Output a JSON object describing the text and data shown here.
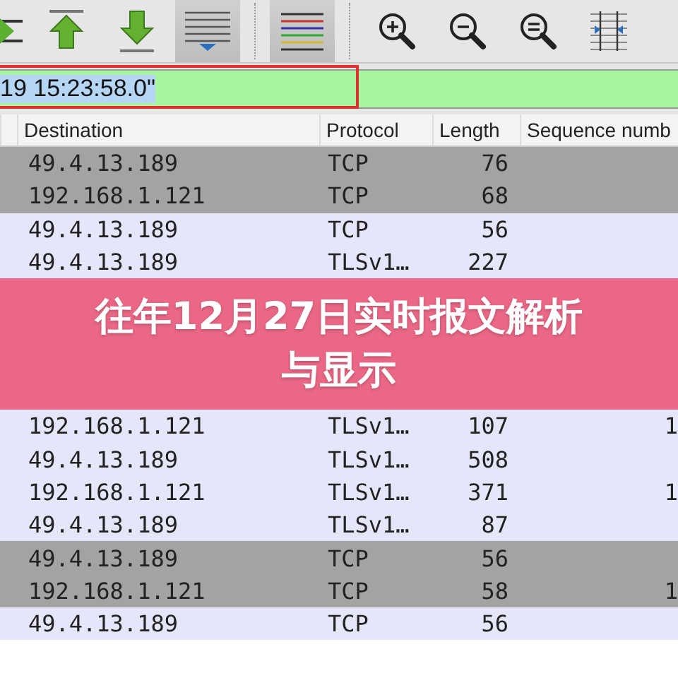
{
  "toolbar": {
    "buttons": [
      {
        "kind": "jump",
        "pressed": false
      },
      {
        "kind": "first",
        "pressed": false
      },
      {
        "kind": "last",
        "pressed": false
      },
      {
        "kind": "autoscroll",
        "pressed": true
      },
      {
        "kind": "colorize",
        "pressed": true
      },
      {
        "kind": "zoom-in",
        "pressed": false
      },
      {
        "kind": "zoom-out",
        "pressed": false
      },
      {
        "kind": "zoom-reset",
        "pressed": false
      },
      {
        "kind": "resize",
        "pressed": false
      }
    ]
  },
  "filter": {
    "value": "19 15:23:58.0\""
  },
  "columns": [
    "Destination",
    "Protocol",
    "Length",
    "Sequence numb"
  ],
  "rows_above": [
    {
      "destination": "49.4.13.189",
      "protocol": "TCP",
      "length": "76",
      "color": "#a3a3a3"
    },
    {
      "destination": "192.168.1.121",
      "protocol": "TCP",
      "length": "68",
      "color": "#a3a3a3"
    },
    {
      "destination": "49.4.13.189",
      "protocol": "TCP",
      "length": "56",
      "color": "#e6e6fa"
    },
    {
      "destination": "49.4.13.189",
      "protocol": "TLSv1…",
      "length": "227",
      "color": "#e6e6fa"
    }
  ],
  "banner": {
    "title": "往年12月27日实时报文解析与显示"
  },
  "rows_below": [
    {
      "destination": "192.168.1.121",
      "protocol": "TLSv1…",
      "length": "107",
      "sequence": "1",
      "color": "#e6e6fa"
    },
    {
      "destination": "49.4.13.189",
      "protocol": "TLSv1…",
      "length": "508",
      "color": "#e6e6fa"
    },
    {
      "destination": "192.168.1.121",
      "protocol": "TLSv1…",
      "length": "371",
      "sequence": "1",
      "color": "#e6e6fa"
    },
    {
      "destination": "49.4.13.189",
      "protocol": "TLSv1…",
      "length": "87",
      "color": "#e6e6fa"
    },
    {
      "destination": "49.4.13.189",
      "protocol": "TCP",
      "length": "56",
      "color": "#a3a3a3"
    },
    {
      "destination": "192.168.1.121",
      "protocol": "TCP",
      "length": "58",
      "sequence": "1",
      "color": "#a3a3a3"
    },
    {
      "destination": "49.4.13.189",
      "protocol": "TCP",
      "length": "56",
      "color": "#e6e6fa"
    }
  ]
}
